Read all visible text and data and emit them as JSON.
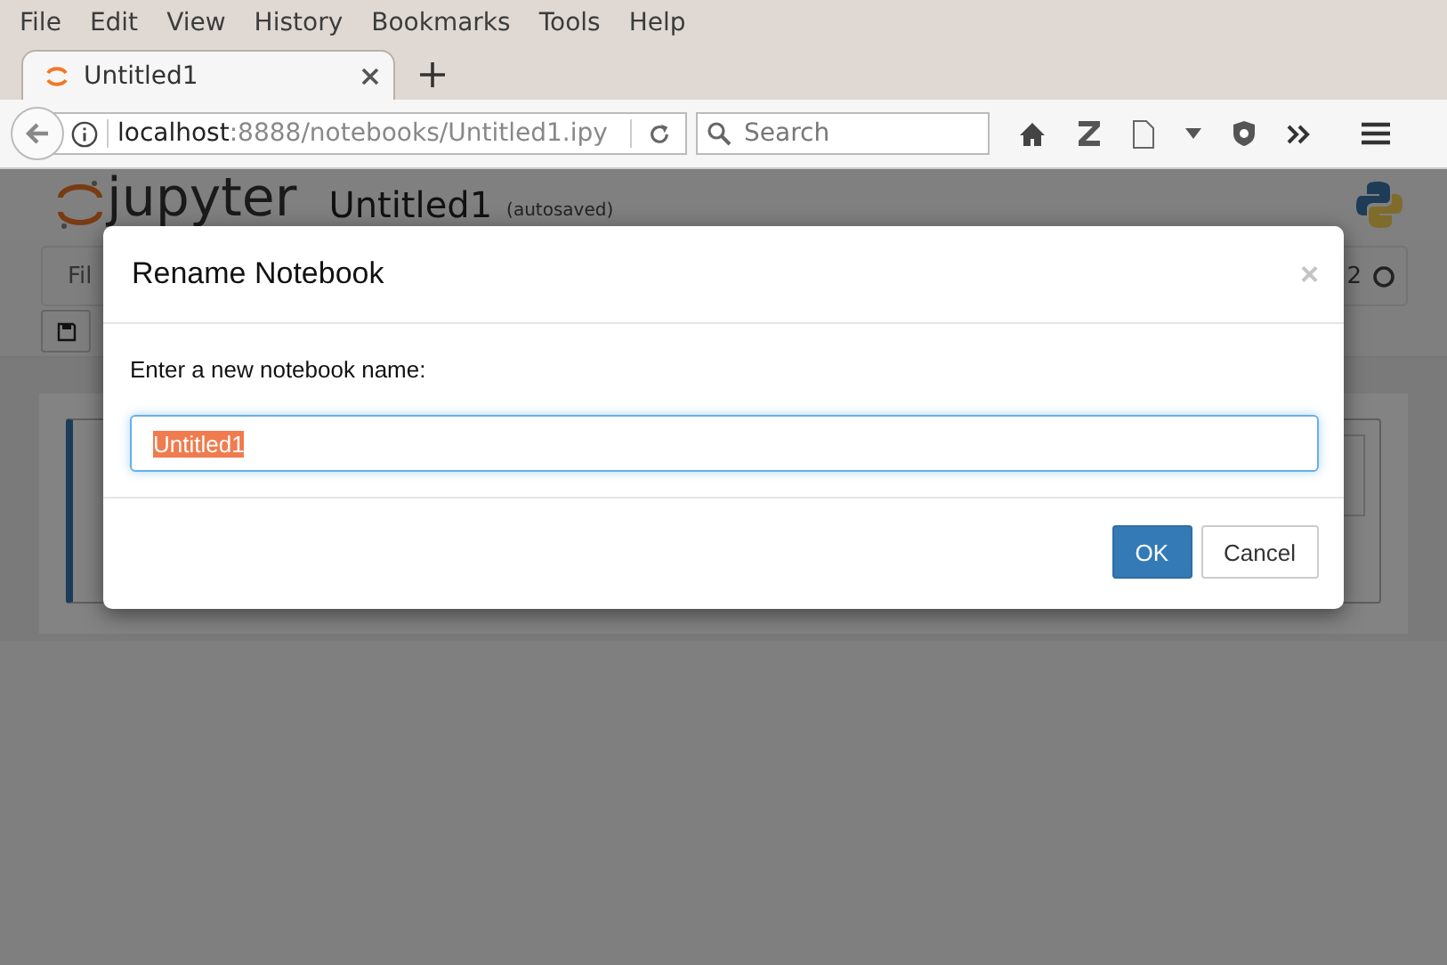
{
  "browser": {
    "menu": [
      "File",
      "Edit",
      "View",
      "History",
      "Bookmarks",
      "Tools",
      "Help"
    ],
    "tabs": [
      {
        "title": "Untitled1",
        "selected": true
      }
    ],
    "url": {
      "host": "localhost",
      "path": ":8888/notebooks/Untitled1.ipy"
    },
    "search": {
      "placeholder": "Search"
    }
  },
  "notebook": {
    "logo": "jupyter",
    "name": "Untitled1",
    "save_status": "(autosaved)",
    "menu_visible": "Fil",
    "kernel_visible": "2"
  },
  "dialog": {
    "title": "Rename Notebook",
    "close": "×",
    "label": "Enter a new notebook name:",
    "input": {
      "value": "Untitled1",
      "text_selected": true
    },
    "buttons": [
      {
        "label": "OK",
        "kind": "primary"
      },
      {
        "label": "Cancel",
        "kind": "default"
      }
    ]
  }
}
